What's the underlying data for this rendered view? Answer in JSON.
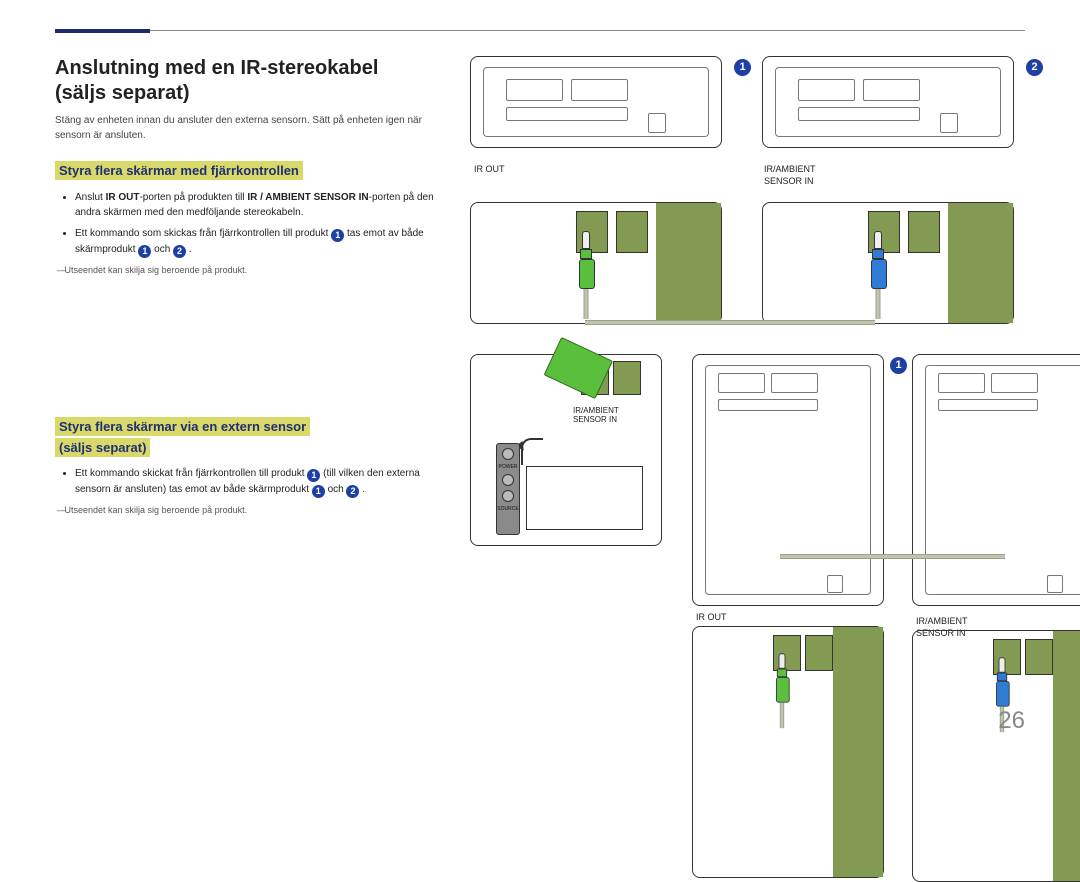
{
  "page_number": "26",
  "title": "Anslutning med en IR-stereokabel (säljs separat)",
  "lede": "Stäng av enheten innan du ansluter den externa sensorn. Sätt på enheten igen när sensorn är ansluten.",
  "section1": {
    "heading": "Styra flera skärmar med fjärrkontrollen",
    "bullet1_a": "Anslut ",
    "bullet1_b": "IR OUT",
    "bullet1_c": "-porten på produkten till ",
    "bullet1_d": "IR / AMBIENT SENSOR IN",
    "bullet1_e": "-porten på den andra skärmen med den medföljande stereokabeln.",
    "bullet2_a": "Ett kommando som skickas från fjärrkontrollen till produkt ",
    "bullet2_b": " tas emot av både skärmprodukt ",
    "bullet2_c": " och ",
    "bullet2_d": " .",
    "footnote": "Utseendet kan skilja sig beroende på produkt."
  },
  "section2": {
    "heading_line1": "Styra flera skärmar via en extern sensor",
    "heading_line2": "(säljs separat)",
    "bullet_a": "Ett kommando skickat från fjärrkontrollen till produkt ",
    "bullet_b": " (till vilken den externa sensorn är ansluten) tas emot av både skärmprodukt ",
    "bullet_c": " och ",
    "bullet_d": " .",
    "footnote": "Utseendet kan skilja sig beroende på produkt."
  },
  "labels": {
    "ir_out": "IR OUT",
    "ir_ambient": "IR/AMBIENT",
    "sensor_in": "SENSOR IN",
    "ir_ambient_sensor_in": "IR/AMBIENT\nSENSOR IN",
    "power": "POWER",
    "source": "SOURCE"
  },
  "nums": {
    "one": "1",
    "two": "2"
  }
}
